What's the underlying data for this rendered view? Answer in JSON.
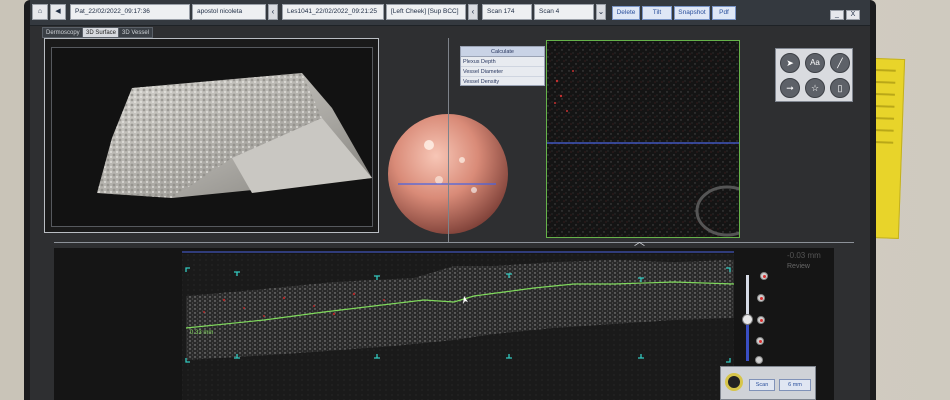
{
  "toolbar": {
    "home_icon": "home-icon",
    "back_icon": "arrow-left-icon",
    "patient_label": "Pat_22/02/2022_09:17:36",
    "patient_name": "apostol nicoleta",
    "lesion_label": "Les1041_22/02/2022_09:21:25",
    "location_label": "[Left Cheek] [Sup BCC]",
    "scan_label": "Scan 174",
    "scan_index": "Scan 4",
    "delete_label": "Delete",
    "tilt_label": "Tilt",
    "snapshot_label": "Snapshot",
    "pdf_label": "Pdf",
    "close_label": "X"
  },
  "tabs": [
    "Dermoscopy",
    "3D Surface",
    "3D Vessel"
  ],
  "active_tab": 1,
  "calculate": {
    "header": "Calculate",
    "rows": [
      "Plexus Depth",
      "Vessel Diameter",
      "Vessel Density"
    ]
  },
  "tools": [
    {
      "icon": "pointer-icon",
      "glyph": "➤"
    },
    {
      "icon": "text-icon",
      "glyph": "Aa"
    },
    {
      "icon": "ruler-icon",
      "glyph": "╱"
    },
    {
      "icon": "arrow-right-icon",
      "glyph": "➞"
    },
    {
      "icon": "star-icon",
      "glyph": "☆"
    },
    {
      "icon": "bookmark-icon",
      "glyph": "▯"
    }
  ],
  "bscan": {
    "depth_label": "0.33 mm",
    "readout": "-0.03 mm",
    "review_label": "Review"
  },
  "scan_control": {
    "left_button": "Scan",
    "right_button": "6 mm"
  },
  "colors": {
    "accent_green": "#7fd85c",
    "marker_cyan": "#33c9c0",
    "scan_line_blue": "#4a63e0"
  }
}
